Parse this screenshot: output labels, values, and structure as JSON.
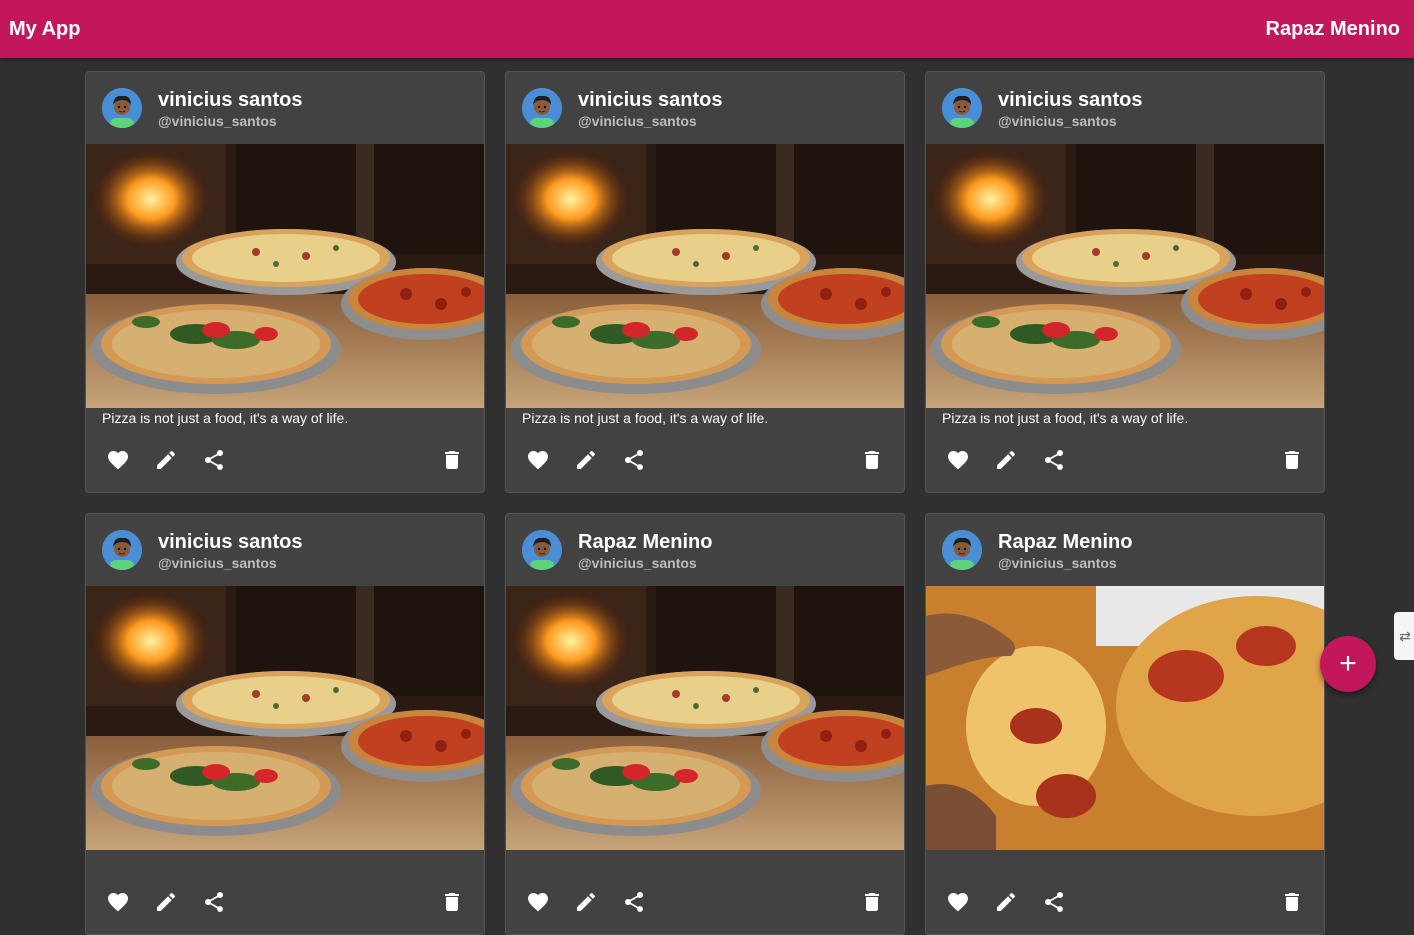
{
  "app": {
    "title": "My App",
    "user": "Rapaz Menino"
  },
  "posts": [
    {
      "author": "vinicius santos",
      "handle": "@vinicius_santos",
      "image": "pizza-oven-photo",
      "caption": "Pizza is not just a food, it's a way of life."
    },
    {
      "author": "vinicius santos",
      "handle": "@vinicius_santos",
      "image": "pizza-oven-photo",
      "caption": "Pizza is not just a food, it's a way of life."
    },
    {
      "author": "vinicius santos",
      "handle": "@vinicius_santos",
      "image": "pizza-oven-photo",
      "caption": "Pizza is not just a food, it's a way of life."
    },
    {
      "author": "vinicius santos",
      "handle": "@vinicius_santos",
      "image": "pizza-oven-photo",
      "caption": ""
    },
    {
      "author": "Rapaz Menino",
      "handle": "@vinicius_santos",
      "image": "pizza-oven-photo",
      "caption": ""
    },
    {
      "author": "Rapaz Menino",
      "handle": "@vinicius_santos",
      "image": "pepperoni-slice-photo",
      "caption": ""
    }
  ],
  "actions": {
    "like_icon": "heart-icon",
    "edit_icon": "pencil-icon",
    "share_icon": "share-icon",
    "delete_icon": "trash-icon"
  },
  "fab": {
    "label": "+",
    "icon": "add-icon"
  },
  "colors": {
    "primary": "#c2185b",
    "background": "#303030",
    "card": "#424242"
  }
}
